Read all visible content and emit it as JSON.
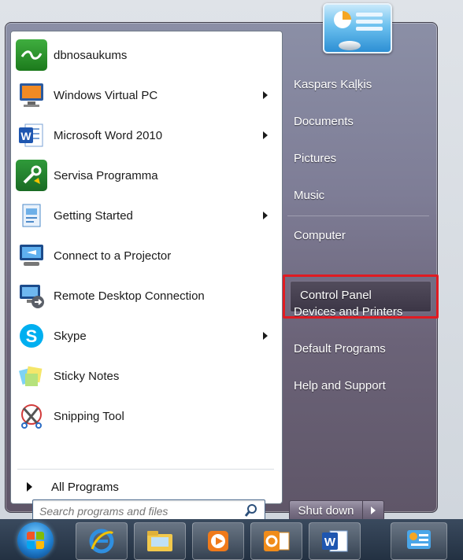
{
  "left_programs": [
    {
      "label": "dbnosaukums",
      "icon": "wave-app-icon",
      "has_submenu": false
    },
    {
      "label": "Windows Virtual PC",
      "icon": "virtual-pc-icon",
      "has_submenu": true
    },
    {
      "label": "Microsoft Word 2010",
      "icon": "word-icon",
      "has_submenu": true
    },
    {
      "label": "Servisa Programma",
      "icon": "service-tool-icon",
      "has_submenu": false
    },
    {
      "label": "Getting Started",
      "icon": "getting-started-icon",
      "has_submenu": true
    },
    {
      "label": "Connect to a Projector",
      "icon": "projector-icon",
      "has_submenu": false
    },
    {
      "label": "Remote Desktop Connection",
      "icon": "remote-desktop-icon",
      "has_submenu": false
    },
    {
      "label": "Skype",
      "icon": "skype-icon",
      "has_submenu": true
    },
    {
      "label": "Sticky Notes",
      "icon": "sticky-notes-icon",
      "has_submenu": false
    },
    {
      "label": "Snipping Tool",
      "icon": "snipping-tool-icon",
      "has_submenu": false
    }
  ],
  "all_programs_label": "All Programs",
  "search": {
    "placeholder": "Search programs and files"
  },
  "right_items": {
    "user": "Kaspars Kaļķis",
    "documents": "Documents",
    "pictures": "Pictures",
    "music": "Music",
    "computer": "Computer",
    "control_panel": "Control Panel",
    "devices": "Devices and Printers",
    "default_programs": "Default Programs",
    "help": "Help and Support"
  },
  "shutdown_label": "Shut down",
  "taskbar_items": [
    "start-orb",
    "internet-explorer-icon",
    "explorer-icon",
    "media-player-icon",
    "outlook-icon",
    "word-icon",
    "control-panel-icon"
  ],
  "colors": {
    "highlight_border": "#e01b22"
  }
}
